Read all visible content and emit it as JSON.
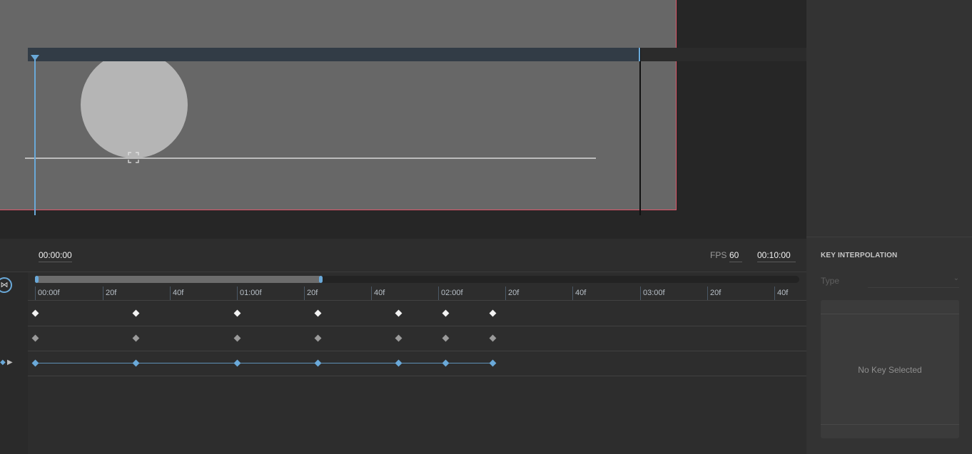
{
  "timeline": {
    "current_time": "00:00:00",
    "fps_label": "FPS",
    "fps_value": "60",
    "duration": "00:10:00",
    "sync_icon": "link-icon",
    "ruler_labels": [
      "00:00f",
      "20f",
      "40f",
      "01:00f",
      "20f",
      "40f",
      "02:00f",
      "20f",
      "40f",
      "03:00f",
      "20f",
      "40f"
    ],
    "tracks": [
      {
        "color": "white",
        "keys": 7
      },
      {
        "color": "gray",
        "keys": 7
      },
      {
        "color": "blue",
        "keys": 7,
        "linked": true
      }
    ]
  },
  "inspector": {
    "title": "KEY INTERPOLATION",
    "type_label": "Type",
    "empty_message": "No Key Selected"
  },
  "colors": {
    "accent": "#6aa9d9",
    "artboard_border": "#e0566a",
    "artboard": "#676767"
  }
}
